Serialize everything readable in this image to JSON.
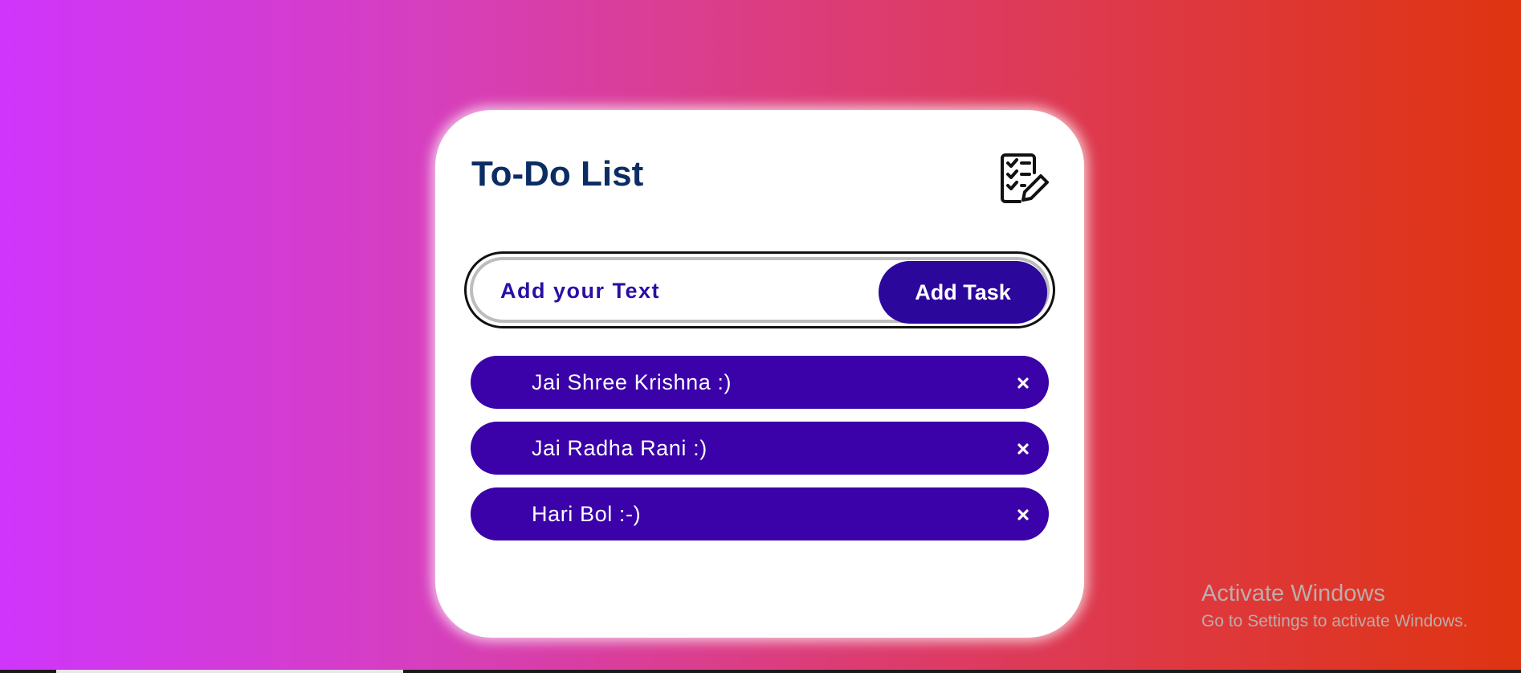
{
  "app": {
    "title": "To-Do List",
    "title_icon": "checklist-pencil-icon"
  },
  "input": {
    "value": "",
    "placeholder": "Add your Text"
  },
  "add_button": {
    "label": "Add Task"
  },
  "tasks": [
    {
      "text": "Jai Shree Krishna :)",
      "delete_icon": "close-icon"
    },
    {
      "text": "Jai Radha Rani :)",
      "delete_icon": "close-icon"
    },
    {
      "text": "Hari Bol :-)",
      "delete_icon": "close-icon"
    }
  ],
  "watermark": {
    "title": "Activate Windows",
    "subtitle": "Go to Settings to activate Windows."
  },
  "colors": {
    "background_start": "#cf35fb",
    "background_end": "#df3410",
    "title": "#0b2d63",
    "accent": "#2c079c",
    "task_bg": "#3a02a8",
    "placeholder": "#2b0ea5"
  }
}
